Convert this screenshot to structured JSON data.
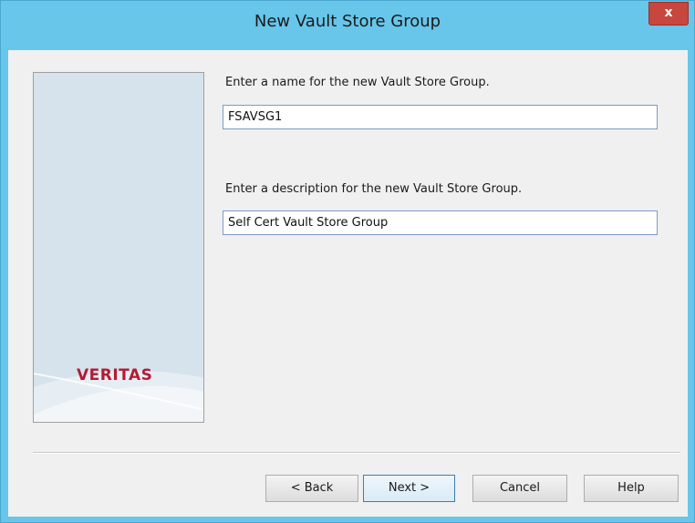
{
  "window": {
    "title": "New Vault Store Group",
    "close_label": "x"
  },
  "brand": {
    "logo_text": "VERITAS",
    "logo_color": "#b31b34"
  },
  "form": {
    "name_label": "Enter a name for the new Vault Store Group.",
    "name_value": "FSAVSG1",
    "description_label": "Enter a description for the new Vault Store Group.",
    "description_value": "Self Cert Vault Store Group"
  },
  "buttons": {
    "back": "< Back",
    "next": "Next >",
    "cancel": "Cancel",
    "help": "Help"
  },
  "colors": {
    "titlebar": "#67c6ea",
    "close": "#c7463d",
    "dialog_bg": "#f0f0f0",
    "panel_bg": "#d6e3ec"
  }
}
